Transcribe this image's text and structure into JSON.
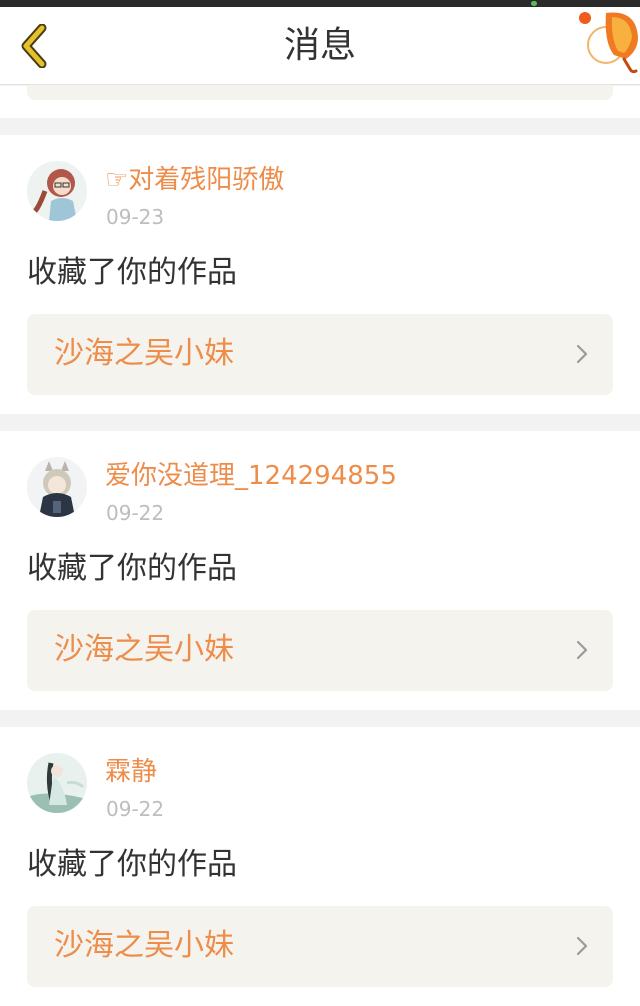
{
  "header": {
    "title": "消息"
  },
  "icons": {
    "back": "chevron-left-icon",
    "lantern": "sky-lantern-icon",
    "row_arrow": "chevron-right-icon"
  },
  "colors": {
    "accent": "#ee8c4a",
    "text": "#333333",
    "muted": "#bdbdbd",
    "card_box": "#f4f3ee",
    "background": "#f2f2f2",
    "back_icon": "#e6c12e"
  },
  "messages": [
    {
      "user": "☞对着残阳骄傲",
      "time": "09-23",
      "action": "收藏了你的作品",
      "work": "沙海之吴小妹"
    },
    {
      "user": "爱你没道理_124294855",
      "time": "09-22",
      "action": "收藏了你的作品",
      "work": "沙海之吴小妹"
    },
    {
      "user": "霖静",
      "time": "09-22",
      "action": "收藏了你的作品",
      "work": "沙海之吴小妹"
    }
  ]
}
